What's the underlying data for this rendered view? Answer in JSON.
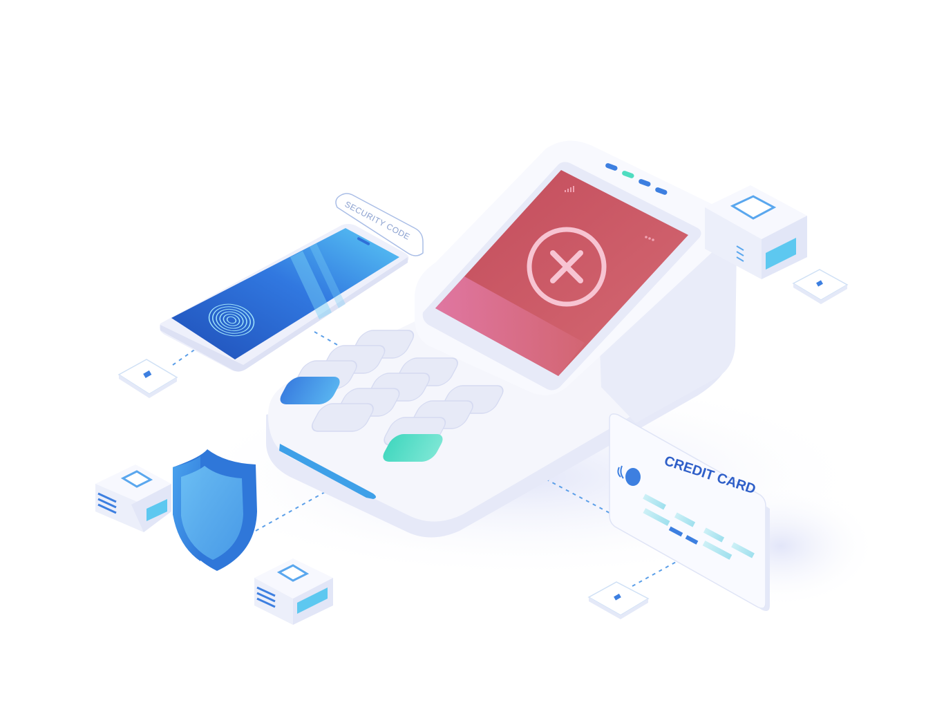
{
  "illustration": {
    "phone_tag": "SECURITY CODE",
    "card_title": "CREDIT CARD",
    "terminal_status_icon": "close-circle-icon",
    "phone_icon": "fingerprint-icon",
    "shield_icon": "shield-icon",
    "card_icon": "contactless-icon"
  },
  "colors": {
    "background": "#ffffff",
    "device_body": "#f3f4fb",
    "device_shadow": "#e3e6f7",
    "screen_red": "#c9515f",
    "screen_pink": "#e070a0",
    "accent_blue": "#3d7fe0",
    "accent_cyan": "#5dc8f0",
    "accent_teal": "#4fdcc0",
    "card_text": "#2f5fc8"
  }
}
